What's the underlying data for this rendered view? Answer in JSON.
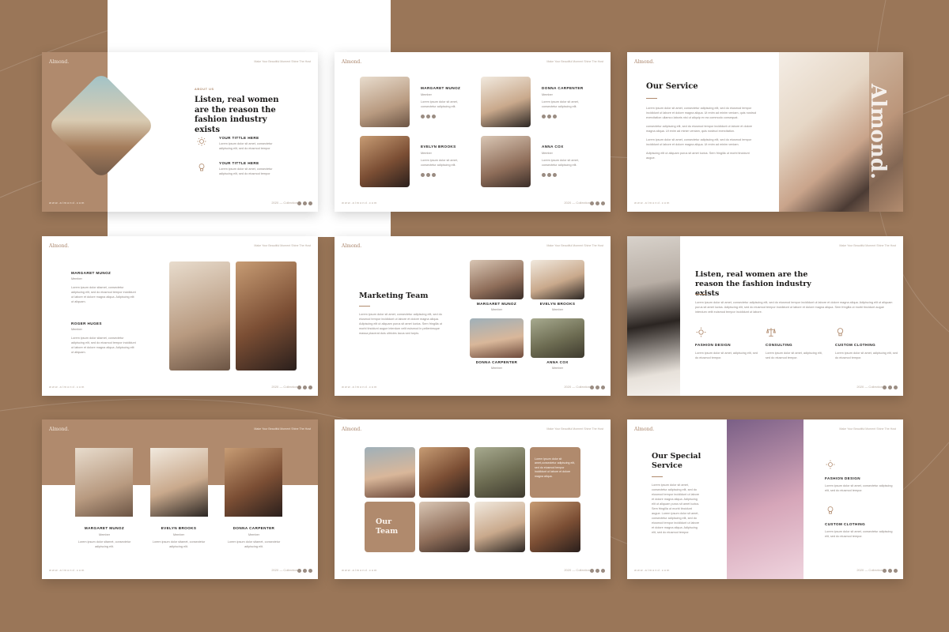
{
  "brand": {
    "logo": "Almond.",
    "tagline": "Make Your Beautiful Moment Shine The Host",
    "footer_url": "www.almond.com",
    "year": "2020 — Collection",
    "accent": "#b08a6d",
    "background": "#9a7658"
  },
  "slide1": {
    "kicker": "ABOUT US",
    "title": "Listen, real women are the reason the fashion industry exists",
    "items": [
      {
        "title": "YOUR TITTLE HERE",
        "text": "Lorem ipsum dolor sit amet, consectetur adipiscing elit, sed do eiusmod tempor",
        "icon": "sun-icon"
      },
      {
        "title": "YOUR TITTLE HERE",
        "text": "Lorem ipsum dolor sit amet, consectetur adipiscing elit, sed do eiusmod tempor",
        "icon": "lightbulb-icon"
      }
    ]
  },
  "slide2": {
    "members": [
      {
        "name": "MARGARET MUNOZ",
        "role": "Member",
        "text": "Lorem ipsum dolor sit amet, consectetur adipiscing elit."
      },
      {
        "name": "DONNA CARPENTER",
        "role": "Member",
        "text": "Lorem ipsum dolor sit amet, consectetur adipiscing elit."
      },
      {
        "name": "EVELYN BROOKS",
        "role": "Member",
        "text": "Lorem ipsum dolor sit amet, consectetur adipiscing elit."
      },
      {
        "name": "ANNA COX",
        "role": "Member",
        "text": "Lorem ipsum dolor sit amet, consectetur adipiscing elit."
      }
    ]
  },
  "slide3": {
    "title": "Our Service",
    "bullets": [
      "Lorem ipsum dolor sit amet, consectetur adipiscing elit, sed do eiusmod tempor incididunt ut labore et dolore magna aliqua. Ut enim ad minim veniam, quis nostrud exercitation ullamco laboris nisi ut aliquip ex ea commodo consequat.",
      "consectetur adipiscing elit, sed do eiusmod tempor incididunt ut labore et dolore magna aliqua. Ut enim ad minim veniam, quis nostrud exercitation.",
      "Lorem ipsum dolor sit amet, consectetur adipiscing elit, sed do eiusmod tempor incididunt ut labore et dolore magna aliqua. Ut enim ad minim veniam.",
      "Adipiscing elit ut aliquam purus sit amet luctus. Sem fringilla ut morbi tincidunt augue."
    ],
    "vertical_word": "Almond."
  },
  "slide4": {
    "people": [
      {
        "name": "MARGARET MUNOZ",
        "role": "Member",
        "text": "Lorem ipsum dolor sitamet, consectetur adipiscing elit, sed do eiusmod tempor incididunt ut labore et dolore magna aliqua. Adipiscing elit ut aliquam."
      },
      {
        "name": "ROGER HUGES",
        "role": "Member",
        "text": "Lorem ipsum dolor sitamet, consectetur adipiscing elit, sed do eiusmod tempor incididunt ut labore et dolore magna aliqua. Adipiscing elit ut aliquam."
      }
    ]
  },
  "slide5": {
    "title": "Marketing Team",
    "text": "Lorem ipsum dolor sit amet, consectetur adipiscing elit, sed do eiusmod tempor incididunt ut labore et dolore magna aliqua. Adipiscing elit ut aliquam purus sit amet luctus. Sem fringilla ut morbi tincidunt augue interdum velit euismod in pellentesque massa placerat duis ultricies lacus sed turpis.",
    "members": [
      {
        "name": "MARGARET MUNOZ",
        "role": "Member"
      },
      {
        "name": "EVELYN BROOKS",
        "role": "Member"
      },
      {
        "name": "DONNA CARPENTER",
        "role": "Member"
      },
      {
        "name": "ANNA COX",
        "role": "Member"
      }
    ]
  },
  "slide6": {
    "title": "Listen, real women are the reason the fashion industry exists",
    "text": "Lorem ipsum dolor sit amet, consectetur adipiscing elit, sed do eiusmod tempor incididunt ut labore et dolore magna aliqua. Adipiscing elit ut aliquam purus sit amet luctus. Adipiscing elit, sed do eiusmod tempor incididunt ut labore et dolore magna aliqua. Sem fringilla ut morbi tincidunt augue interdum velit euismod tempor incididunt ut labore.",
    "features": [
      {
        "title": "FASHION DESIGN",
        "text": "Lorem ipsum dolor sit amet, adipiscing elit, sed do eiusmod tempor.",
        "icon": "sun-icon"
      },
      {
        "title": "CONSULTING",
        "text": "Lorem ipsum dolor sit amet, adipiscing elit, sed do eiusmod tempor.",
        "icon": "scales-icon"
      },
      {
        "title": "CUSTOM CLOTHING",
        "text": "Lorem ipsum dolor sit amet, adipiscing elit, sed do eiusmod tempor.",
        "icon": "lightbulb-icon"
      }
    ]
  },
  "slide7": {
    "members": [
      {
        "name": "MARGARET MUNOZ",
        "role": "Member",
        "text": "Lorem ipsum dolor sitamet, consectetur adipiscing elit."
      },
      {
        "name": "EVELYN BROOKS",
        "role": "Member",
        "text": "Lorem ipsum dolor sitamet, consectetur adipiscing elit."
      },
      {
        "name": "DONNA CARPENTER",
        "role": "Member",
        "text": "Lorem ipsum dolor sitamet, consectetur adipiscing elit."
      }
    ]
  },
  "slide8": {
    "title_line1": "Our",
    "title_line2": "Team",
    "text": "Lorem ipsum dolor sit amet,consectetur adipiscing elit, sed do eiusmod tempor incididunt ut labore et dolore magna aliqua."
  },
  "slide9": {
    "title": "Our Special Service",
    "text": "Lorem ipsum dolor sit amet, consectetur adipiscing elit, sed do eiusmod tempor incididunt ut labore et dolore magna aliqua. Adipiscing elit ut aliquam purus sit amet luctus. Sem fringilla ut morbi tincidunt augue. Lorem ipsum dolor sit amet, consectetur adipiscing elit, sed do eiusmod tempor incididunt ut labore et dolore magna aliqua. Adipiscing elit, sed do eiusmod tempor.",
    "features": [
      {
        "title": "FASHION DESIGN",
        "text": "Lorem ipsum dolor sit amet, consectetur adipiscing elit, sed do eiusmod tempor.",
        "icon": "sun-icon"
      },
      {
        "title": "CUSTOM CLOTHING",
        "text": "Lorem ipsum dolor sit amet, consectetur adipiscing elit, sed do eiusmod tempor.",
        "icon": "lightbulb-icon"
      }
    ]
  }
}
